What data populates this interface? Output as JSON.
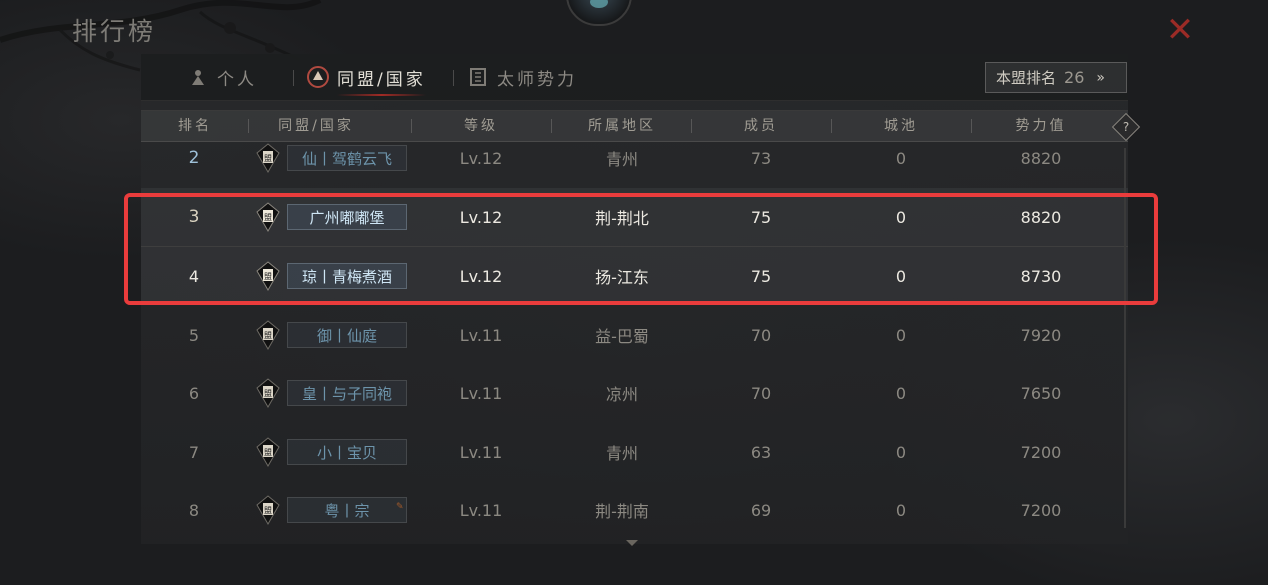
{
  "header": {
    "title": "排行榜"
  },
  "tabs": [
    {
      "label": "个人",
      "icon": "person-icon",
      "active": false
    },
    {
      "label": "同盟/国家",
      "icon": "alliance-icon",
      "active": true
    },
    {
      "label": "太师势力",
      "icon": "banner-icon",
      "active": false
    }
  ],
  "alliance_rank_button": {
    "label": "本盟排名",
    "value": "26",
    "arrow": "»"
  },
  "columns": [
    "排名",
    "同盟/国家",
    "等级",
    "所属地区",
    "成员",
    "城池",
    "势力值"
  ],
  "help_icon": "?",
  "flag_glyph": "盟",
  "rows": [
    {
      "rank": "2",
      "name": "仙丨驾鹤云飞",
      "level": "Lv.12",
      "region": "青州",
      "members": "73",
      "cities": "0",
      "power": "8820"
    },
    {
      "rank": "3",
      "name": "广州嘟嘟堡",
      "level": "Lv.12",
      "region": "荆-荆北",
      "members": "75",
      "cities": "0",
      "power": "8820"
    },
    {
      "rank": "4",
      "name": "琼丨青梅煮酒",
      "level": "Lv.12",
      "region": "扬-江东",
      "members": "75",
      "cities": "0",
      "power": "8730"
    },
    {
      "rank": "5",
      "name": "御丨仙庭",
      "level": "Lv.11",
      "region": "益-巴蜀",
      "members": "70",
      "cities": "0",
      "power": "7920"
    },
    {
      "rank": "6",
      "name": "皇丨与子同袍",
      "level": "Lv.11",
      "region": "凉州",
      "members": "70",
      "cities": "0",
      "power": "7650"
    },
    {
      "rank": "7",
      "name": "小丨宝贝",
      "level": "Lv.11",
      "region": "青州",
      "members": "63",
      "cities": "0",
      "power": "7200"
    },
    {
      "rank": "8",
      "name": "粤丨宗",
      "level": "Lv.11",
      "region": "荆-荆南",
      "members": "69",
      "cities": "0",
      "power": "7200"
    }
  ],
  "colors": {
    "highlight_border": "#ea3c3c",
    "close": "#9b2b26",
    "name_link": "#6d94ab"
  }
}
